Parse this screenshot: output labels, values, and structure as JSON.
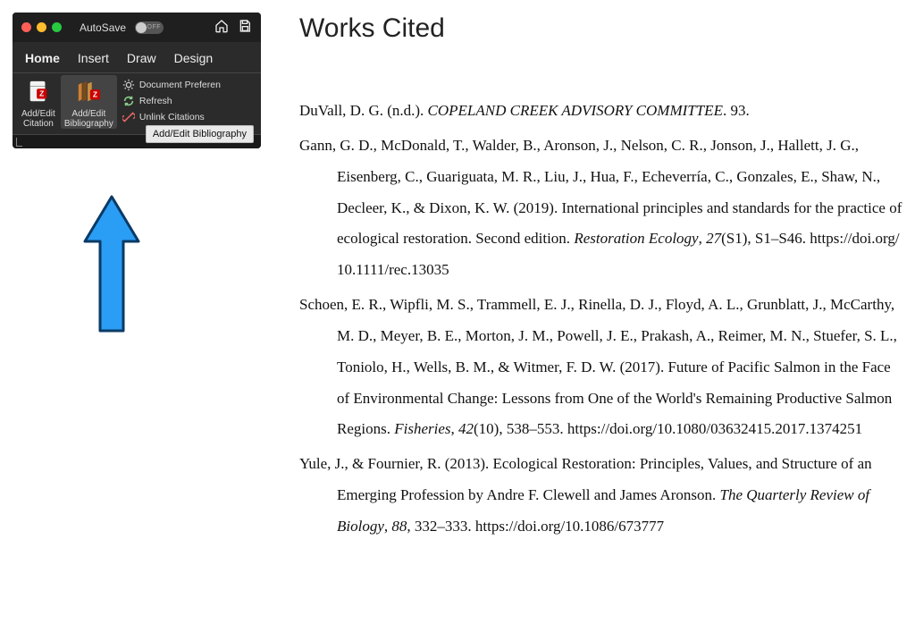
{
  "word_panel": {
    "autosave_label": "AutoSave",
    "autosave_state": "OFF",
    "tabs": [
      "Home",
      "Insert",
      "Draw",
      "Design"
    ],
    "ribbon": {
      "add_edit_citation": {
        "line1": "Add/Edit",
        "line2": "Citation"
      },
      "add_edit_bibliography": {
        "line1": "Add/Edit",
        "line2": "Bibliography"
      },
      "small": {
        "doc_prefs": "Document Preferen",
        "refresh": "Refresh",
        "unlink": "Unlink Citations"
      }
    },
    "tooltip": "Add/Edit Bibliography"
  },
  "doc": {
    "title": "Works Cited",
    "entries": [
      {
        "authors": "DuVall, D. G. (n.d.). ",
        "title_italic": "COPELAND CREEK ADVISORY COMMITTEE",
        "after_title": ". 93."
      },
      {
        "authors": "Gann, G. D., McDonald, T., Walder, B., Aronson, J., Nelson, C. R., Jonson, J., Hallett, J. G., Eisenberg, C., Guariguata, M. R., Liu, J., Hua, F., Echeverría, C., Gonzales, E., Shaw, N., Decleer, K., & Dixon, K. W. (2019). International principles and standards for the practice of ecological restoration. Second edition. ",
        "journal_italic": "Restoration Ecology",
        "after_journal": ", ",
        "vol_italic": "27",
        "after_vol": "(S1), S1–S46. ",
        "doi": "https://doi.org/10.1111/rec.13035"
      },
      {
        "authors": "Schoen, E. R., Wipfli, M. S., Trammell, E. J., Rinella, D. J., Floyd, A. L., Grunblatt, J., McCarthy, M. D., Meyer, B. E., Morton, J. M., Powell, J. E., Prakash, A., Reimer, M. N., Stuefer, S. L., Toniolo, H., Wells, B. M., & Witmer, F. D. W. (2017). Future of Pacific Salmon in the Face of Environmental Change: Lessons from One of the World's Remaining Productive Salmon Regions. ",
        "journal_italic": "Fisheries",
        "after_journal": ", ",
        "vol_italic": "42",
        "after_vol": "(10), 538–553. ",
        "doi": "https://doi.org/10.1080/03632415.2017.1374251"
      },
      {
        "authors": "Yule, J., & Fournier, R. (2013). Ecological Restoration: Principles, Values, and Structure of an Emerging Profession by Andre F. Clewell and James Aronson. ",
        "journal_italic": "The Quarterly Review of Biology",
        "after_journal": ", ",
        "vol_italic": "88",
        "after_vol": ", 332–333. ",
        "doi": "https://doi.org/10.1086/673777"
      }
    ]
  }
}
